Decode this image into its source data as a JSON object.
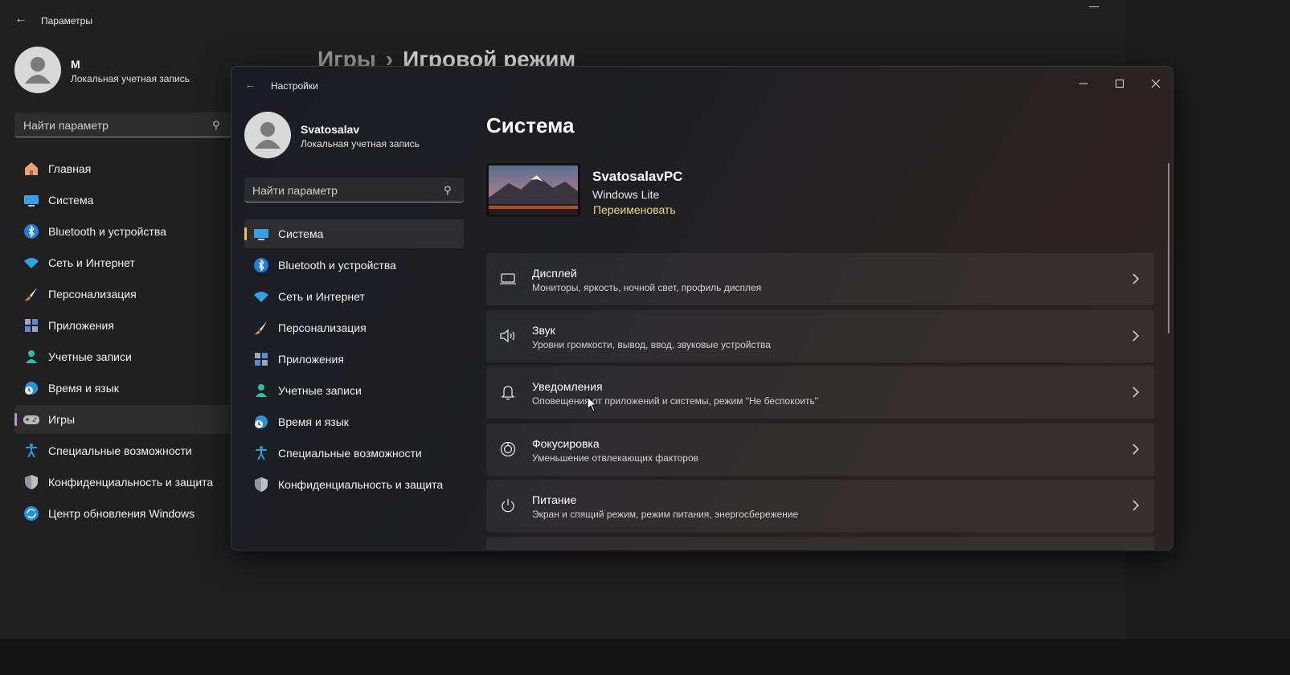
{
  "background_window": {
    "title": "Параметры",
    "user": {
      "name": "M",
      "account_type": "Локальная учетная запись"
    },
    "search": {
      "placeholder": "Найти параметр"
    },
    "breadcrumb": {
      "parent": "Игры",
      "separator": "›",
      "current": "Игровой режим"
    },
    "nav": [
      {
        "label": "Главная",
        "icon": "home-icon"
      },
      {
        "label": "Система",
        "icon": "monitor-icon"
      },
      {
        "label": "Bluetooth и устройства",
        "icon": "bluetooth-icon"
      },
      {
        "label": "Сеть и Интернет",
        "icon": "wifi-icon"
      },
      {
        "label": "Персонализация",
        "icon": "brush-icon"
      },
      {
        "label": "Приложения",
        "icon": "apps-icon"
      },
      {
        "label": "Учетные записи",
        "icon": "person-icon"
      },
      {
        "label": "Время и язык",
        "icon": "globe-clock-icon"
      },
      {
        "label": "Игры",
        "icon": "gamepad-icon",
        "active": true
      },
      {
        "label": "Специальные возможности",
        "icon": "accessibility-icon"
      },
      {
        "label": "Конфиденциальность и защита",
        "icon": "shield-icon"
      },
      {
        "label": "Центр обновления Windows",
        "icon": "update-icon"
      }
    ]
  },
  "foreground_window": {
    "title": "Настройки",
    "user": {
      "name": "Svatosalav",
      "account_type": "Локальная учетная запись"
    },
    "search": {
      "placeholder": "Найти параметр"
    },
    "nav": [
      {
        "label": "Система",
        "icon": "monitor-icon",
        "active": true
      },
      {
        "label": "Bluetooth и устройства",
        "icon": "bluetooth-icon"
      },
      {
        "label": "Сеть и Интернет",
        "icon": "wifi-icon"
      },
      {
        "label": "Персонализация",
        "icon": "brush-icon"
      },
      {
        "label": "Приложения",
        "icon": "apps-icon"
      },
      {
        "label": "Учетные записи",
        "icon": "person-icon"
      },
      {
        "label": "Время и язык",
        "icon": "globe-clock-icon"
      },
      {
        "label": "Специальные возможности",
        "icon": "accessibility-icon"
      },
      {
        "label": "Конфиденциальность и защита",
        "icon": "shield-icon"
      }
    ],
    "page_title": "Система",
    "device": {
      "name": "SvatosalavPC",
      "edition": "Windows Lite",
      "rename_label": "Переименовать"
    },
    "cards": [
      {
        "title": "Дисплей",
        "subtitle": "Мониторы, яркость, ночной свет, профиль дисплея",
        "icon": "display-icon"
      },
      {
        "title": "Звук",
        "subtitle": "Уровни громкости, вывод, ввод, звуковые устройства",
        "icon": "speaker-icon"
      },
      {
        "title": "Уведомления",
        "subtitle": "Оповещения от приложений и системы, режим \"Не беспокоить\"",
        "icon": "bell-icon"
      },
      {
        "title": "Фокусировка",
        "subtitle": "Уменьшение отвлекающих факторов",
        "icon": "focus-icon"
      },
      {
        "title": "Питание",
        "subtitle": "Экран и спящий режим, режим питания, энергосбережение",
        "icon": "power-icon"
      }
    ]
  },
  "colors": {
    "accent_fg": "#f0c453",
    "accent_bg": "#c28be8",
    "rename_link": "#f1d58a"
  }
}
